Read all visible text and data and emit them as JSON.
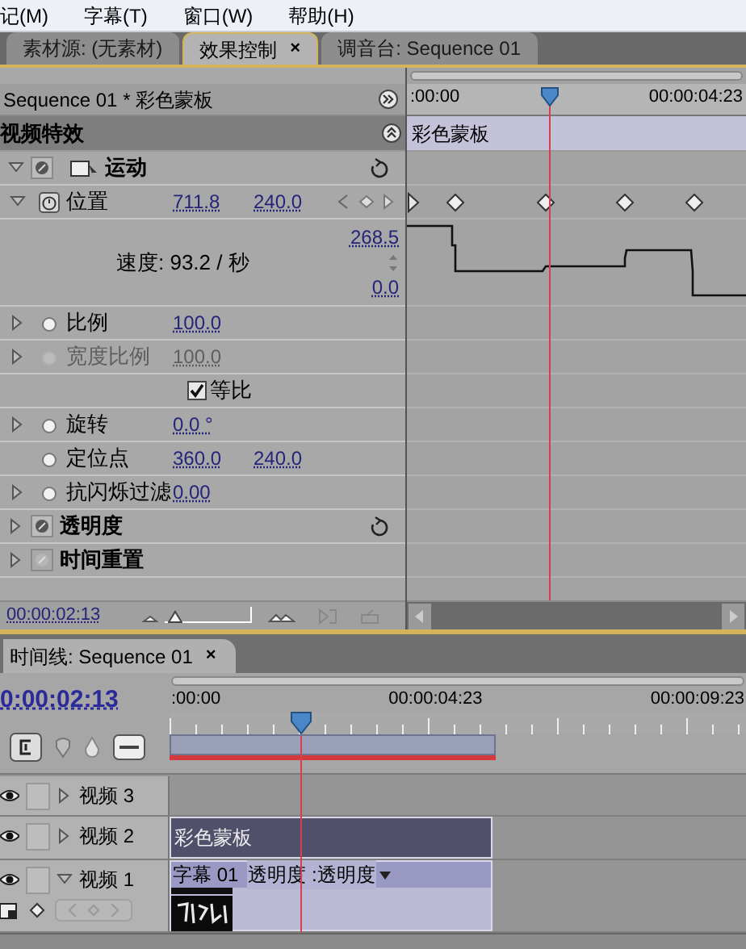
{
  "menu": [
    "记(M)",
    "字幕(T)",
    "窗口(W)",
    "帮助(H)"
  ],
  "tabs": [
    {
      "label": "素材源: (无素材)",
      "selected": false
    },
    {
      "label": "效果控制",
      "selected": true,
      "close": "×"
    },
    {
      "label": "调音台: Sequence 01",
      "selected": false
    }
  ],
  "effect_controls": {
    "header": "Sequence 01 * 彩色蒙板",
    "ruler": [
      ":00:00",
      "00:00:04:23"
    ],
    "playhead": {
      "level": 0.42
    },
    "section": "视频特效",
    "clip": "彩色蒙板",
    "rows": [
      {
        "kind": "effect",
        "label": "运动",
        "expanded": true,
        "enabled": true,
        "motion_icon": true,
        "reset_button": true
      },
      {
        "kind": "param",
        "label": "位置",
        "expanded": true,
        "animated": true,
        "values": [
          "711.8",
          "240.0"
        ]
      },
      {
        "kind": "graph",
        "label": "速度: 93.2 / 秒",
        "max": "268.5",
        "min": "0.0"
      },
      {
        "kind": "param",
        "label": "比例",
        "expanded": false,
        "animated": false,
        "values": [
          "100.0"
        ]
      },
      {
        "kind": "param",
        "label": "宽度比例",
        "expanded": false,
        "animated": false,
        "disabled": true,
        "values": [
          "100.0"
        ]
      },
      {
        "kind": "checkbox",
        "label": "等比",
        "checked": true
      },
      {
        "kind": "param",
        "label": "旋转",
        "expanded": false,
        "animated": false,
        "values": [
          "0.0 °"
        ]
      },
      {
        "kind": "param",
        "label": "定位点",
        "animated": false,
        "values": [
          "360.0",
          "240.0"
        ]
      },
      {
        "kind": "param",
        "label": "抗闪烁过滤",
        "expanded": false,
        "animated": false,
        "values": [
          "0.00"
        ]
      },
      {
        "kind": "effect",
        "label": "透明度",
        "expanded": false,
        "enabled": true,
        "motion_icon": false,
        "reset_button": true
      },
      {
        "kind": "effect",
        "label": "时间重置",
        "expanded": false,
        "enabled": false,
        "motion_icon": false,
        "reset_button": false
      }
    ],
    "timecode": "00:00:02:13",
    "zoom": {
      "level": 0.05
    }
  },
  "timeline": {
    "title": "时间线: Sequence 01",
    "close": "×",
    "timecode": "0:00:02:13",
    "ruler": [
      ":00:00",
      "00:00:04:23",
      "00:00:09:23"
    ],
    "playhead": {
      "level": 0.227
    },
    "tracks": [
      {
        "name": "视频 3",
        "expanded": false
      },
      {
        "name": "视频 2",
        "expanded": false,
        "clip": "彩色蒙板"
      },
      {
        "name": "视频 1",
        "expanded": true,
        "clip": "字幕 01",
        "property": "透明度 :透明度"
      }
    ]
  }
}
